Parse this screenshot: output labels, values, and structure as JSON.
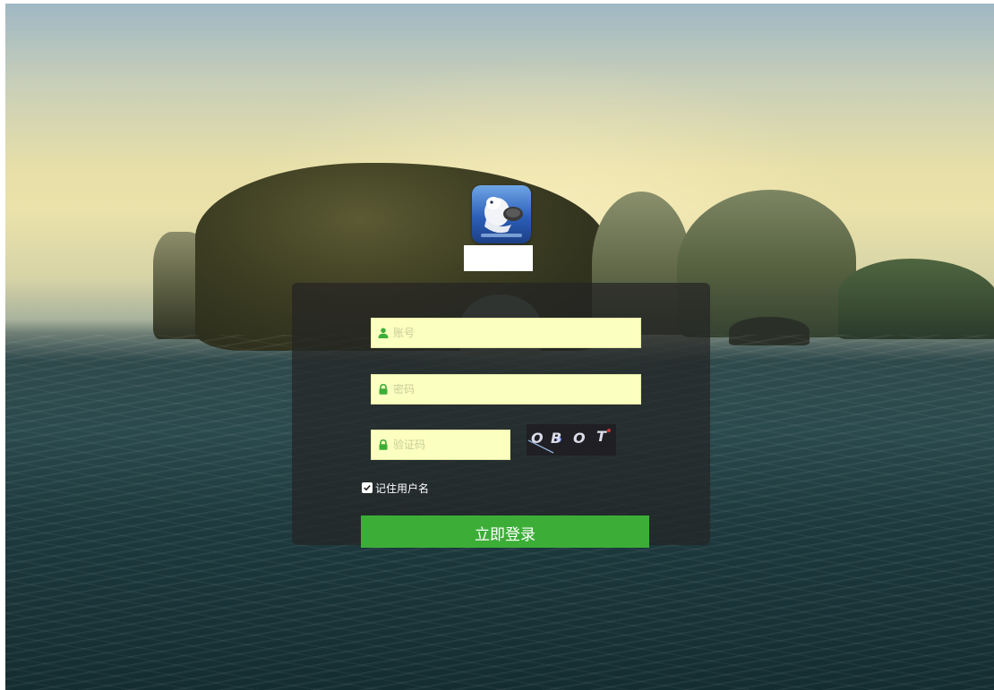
{
  "form": {
    "username": {
      "placeholder": "账号",
      "value": "",
      "icon": "user-icon"
    },
    "password": {
      "placeholder": "密码",
      "value": "",
      "icon": "lock-icon"
    },
    "captcha": {
      "placeholder": "验证码",
      "value": "",
      "icon": "lock-icon",
      "image_text": [
        "O",
        "B",
        "O",
        "T"
      ]
    },
    "remember": {
      "label": "记住用户名",
      "checked": true
    },
    "submit_label": "立即登录"
  },
  "colors": {
    "accent": "#3cae38",
    "field_bg": "#fbffbf",
    "panel_bg": "rgba(36,36,36,0.72)"
  }
}
